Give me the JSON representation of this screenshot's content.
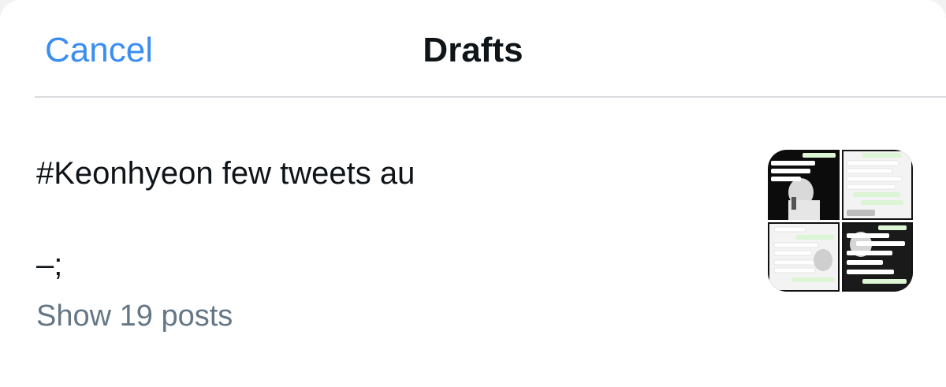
{
  "header": {
    "cancel_label": "Cancel",
    "title": "Drafts"
  },
  "draft": {
    "text_line1": "#Keonhyeon few tweets au",
    "text_line2": "–;",
    "show_posts_label": "Show 19 posts"
  },
  "colors": {
    "accent": "#3b8ef0",
    "text_primary": "#0f1419",
    "text_secondary": "#657786",
    "divider": "#d9dcdf"
  }
}
